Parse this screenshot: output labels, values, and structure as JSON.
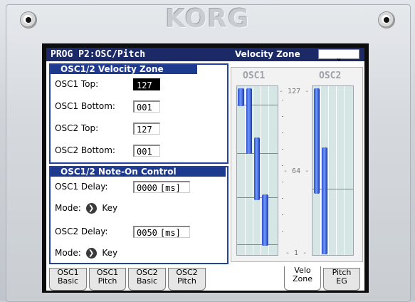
{
  "device": {
    "logo": "KORG"
  },
  "header": {
    "page_title": "PROG P2:OSC/Pitch",
    "section_title": "Velocity Zone",
    "menu_icon": "chevron-down-icon"
  },
  "velocity_zone": {
    "heading": "OSC1/2 Velocity Zone",
    "rows": [
      {
        "label": "OSC1 Top:",
        "value": "127"
      },
      {
        "label": "OSC1 Bottom:",
        "value": "001"
      },
      {
        "label": "OSC2 Top:",
        "value": "127"
      },
      {
        "label": "OSC2 Bottom:",
        "value": "001"
      }
    ]
  },
  "note_on_control": {
    "heading": "OSC1/2 Note-On Control",
    "osc1_delay_label": "OSC1 Delay:",
    "osc1_delay_value": "0000",
    "osc1_delay_unit": "[ms]",
    "osc1_mode_label": "Mode:",
    "osc1_mode_value": "Key",
    "osc2_delay_label": "OSC2 Delay:",
    "osc2_delay_value": "0050",
    "osc2_delay_unit": "[ms]",
    "osc2_mode_label": "Mode:",
    "osc2_mode_value": "Key"
  },
  "graph": {
    "osc1_label": "OSC1",
    "osc2_label": "OSC2",
    "scale": {
      "top": "127",
      "mid": "64",
      "bottom": "1"
    }
  },
  "tabs": [
    {
      "line1": "OSC1",
      "line2": "Basic"
    },
    {
      "line1": "OSC1",
      "line2": "Pitch"
    },
    {
      "line1": "OSC2",
      "line2": "Basic"
    },
    {
      "line1": "OSC2",
      "line2": "Pitch"
    },
    {
      "line1": "Velo",
      "line2": "Zone"
    },
    {
      "line1": "Pitch",
      "line2": "EG"
    }
  ],
  "colors": {
    "title_bar": "#1b2a66",
    "panel_head": "#1e3a8f",
    "graph_bg": "#d6e6e4"
  }
}
